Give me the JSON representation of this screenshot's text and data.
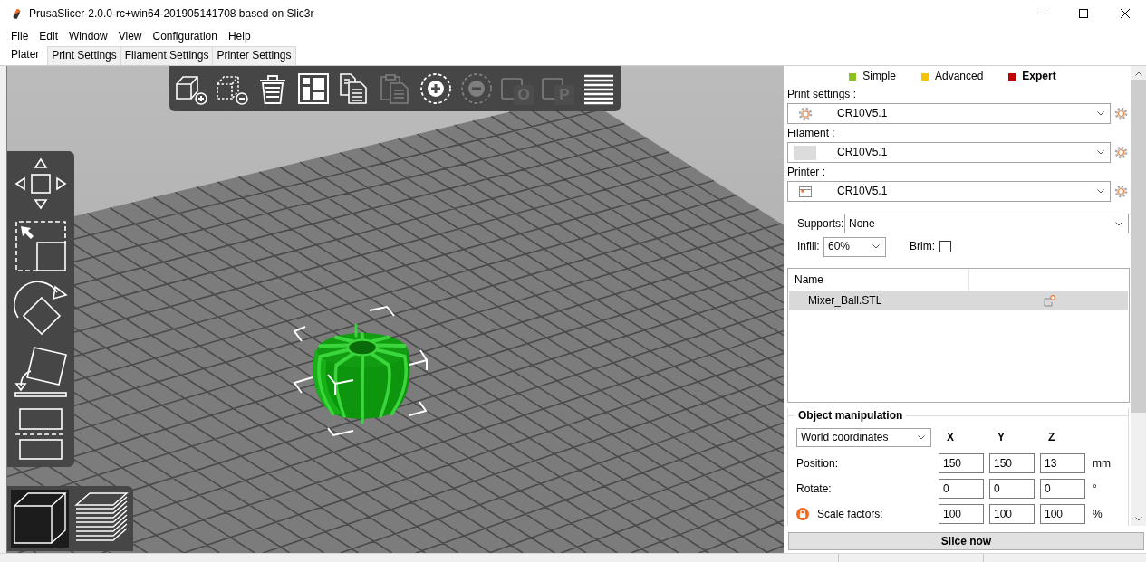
{
  "window": {
    "title": "PrusaSlicer-2.0.0-rc+win64-201905141708 based on Slic3r"
  },
  "menu": [
    "File",
    "Edit",
    "Window",
    "View",
    "Configuration",
    "Help"
  ],
  "tabs": [
    {
      "label": "Plater",
      "selected": true
    },
    {
      "label": "Print Settings",
      "selected": false
    },
    {
      "label": "Filament Settings",
      "selected": false
    },
    {
      "label": "Printer Settings",
      "selected": false
    }
  ],
  "toolbar": [
    {
      "kind": "add",
      "disabled": false
    },
    {
      "kind": "delete",
      "disabled": false
    },
    {
      "kind": "delete_all",
      "disabled": false
    },
    {
      "kind": "arrange",
      "disabled": false
    },
    {
      "kind": "copy",
      "disabled": false
    },
    {
      "kind": "paste",
      "disabled": true
    },
    {
      "kind": "add_instance",
      "disabled": false
    },
    {
      "kind": "remove_instance",
      "disabled": true
    },
    {
      "kind": "split_objects",
      "letter": "O",
      "disabled": true
    },
    {
      "kind": "split_parts",
      "letter": "P",
      "disabled": true
    },
    {
      "kind": "layers",
      "disabled": false
    }
  ],
  "gizmos": [
    {
      "kind": "move",
      "selected": false
    },
    {
      "kind": "scale",
      "selected": false
    },
    {
      "kind": "rotate",
      "selected": false
    },
    {
      "kind": "place_on_face",
      "selected": false
    },
    {
      "kind": "cut",
      "selected": false
    }
  ],
  "view_modes": [
    {
      "kind": "model",
      "selected": true
    },
    {
      "kind": "preview",
      "selected": false
    }
  ],
  "scene": {
    "object_selected": true
  },
  "modes": [
    {
      "label": "Simple",
      "color": "#8dc21f",
      "selected": false
    },
    {
      "label": "Advanced",
      "color": "#f5c400",
      "selected": false
    },
    {
      "label": "Expert",
      "color": "#c00000",
      "selected": true
    }
  ],
  "presets": [
    {
      "kind": "print",
      "label": "Print settings :",
      "value": "CR10V5.1"
    },
    {
      "kind": "filament",
      "label": "Filament :",
      "value": "CR10V5.1"
    },
    {
      "kind": "printer",
      "label": "Printer :",
      "value": "CR10V5.1"
    }
  ],
  "supports": {
    "label": "Supports:",
    "value": "None"
  },
  "infill": {
    "label": "Infill:",
    "value": "60%"
  },
  "brim": {
    "label": "Brim:",
    "checked": false
  },
  "object_list": {
    "columns": [
      "Name"
    ],
    "rows": [
      {
        "name": "Mixer_Ball.STL",
        "selected": true
      }
    ]
  },
  "object_manipulation": {
    "title": "Object manipulation",
    "coordinates": "World coordinates",
    "axes": [
      "X",
      "Y",
      "Z"
    ],
    "rows": [
      {
        "kind": "plain",
        "label": "Position:",
        "values": [
          "150",
          "150",
          "13"
        ],
        "unit": "mm"
      },
      {
        "kind": "plain",
        "label": "Rotate:",
        "values": [
          "0",
          "0",
          "0"
        ],
        "unit": "°"
      },
      {
        "kind": "locked",
        "label": "Scale factors:",
        "values": [
          "100",
          "100",
          "100"
        ],
        "unit": "%"
      }
    ]
  },
  "slice_button": {
    "label": "Slice now"
  }
}
